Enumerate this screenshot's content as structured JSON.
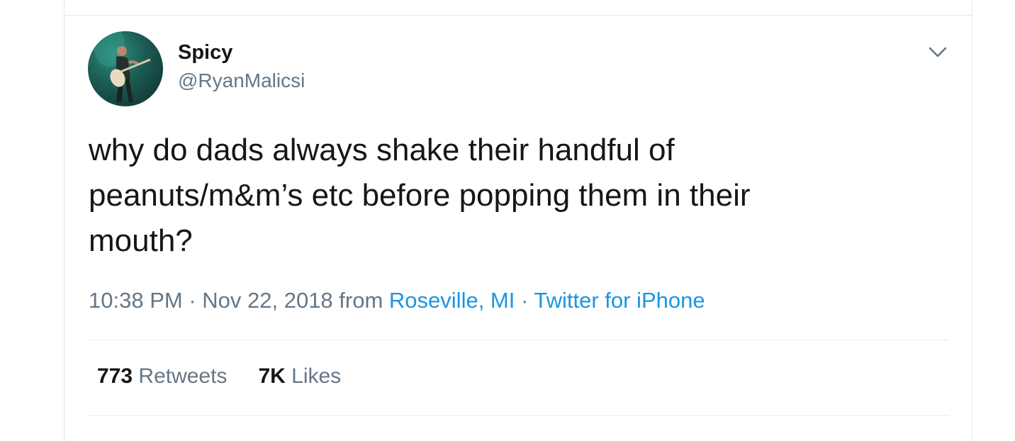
{
  "tweet": {
    "display_name": "Spicy",
    "handle": "@RyanMalicsi",
    "text": "why do dads always shake their handful of\npeanuts/m&m’s etc before popping them in their\nmouth?",
    "time": "10:38 PM",
    "separator": " · ",
    "date": "Nov 22, 2018",
    "from_label": " from ",
    "location": "Roseville, MI",
    "source": "Twitter for iPhone",
    "avatar_icon": "user-avatar-guitarist",
    "caret_icon": "chevron-down-icon"
  },
  "stats": {
    "retweets_count": "773",
    "retweets_label": " Retweets",
    "likes_count": "7K",
    "likes_label": " Likes"
  },
  "colors": {
    "text": "#14171a",
    "secondary": "#657786",
    "link": "#1b95e0",
    "border": "#e1e8ed"
  }
}
